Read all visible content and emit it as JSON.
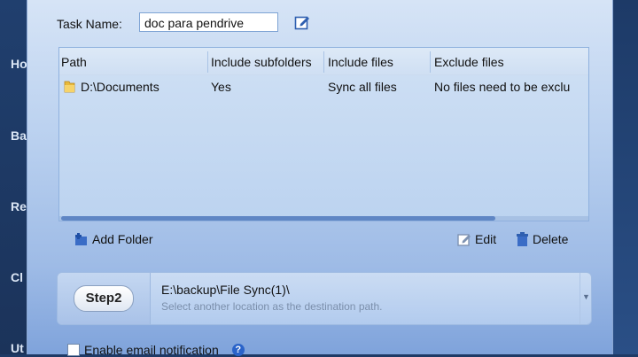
{
  "sidebar": {
    "items": [
      "Ho",
      "Ba",
      "Re",
      "Cl",
      "Ut"
    ]
  },
  "task": {
    "label": "Task Name:",
    "value": "doc para pendrive"
  },
  "table": {
    "columns": [
      "Path",
      "Include subfolders",
      "Include files",
      "Exclude files"
    ],
    "rows": [
      {
        "path": "D:\\Documents",
        "subfolders": "Yes",
        "include": "Sync all files",
        "exclude": "No files need to be exclu"
      }
    ]
  },
  "toolbar": {
    "add_folder": "Add Folder",
    "edit": "Edit",
    "delete": "Delete"
  },
  "step2": {
    "badge": "Step2",
    "path": "E:\\backup\\File Sync(1)\\",
    "hint": "Select another location as the destination path."
  },
  "email": {
    "label": "Enable email notification",
    "help": "?"
  }
}
